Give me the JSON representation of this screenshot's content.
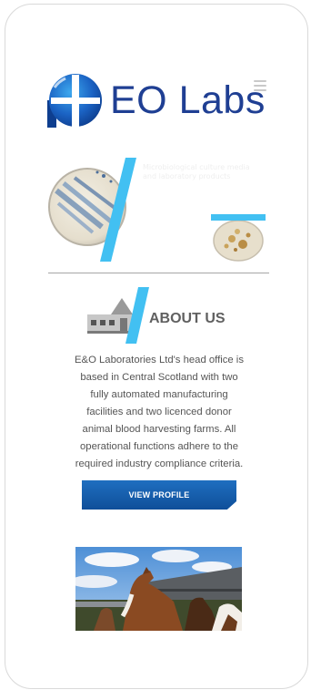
{
  "header": {
    "logo_text": "EO Labs",
    "menu_icon": "hamburger-menu-icon"
  },
  "banner": {
    "caption": "Microbiological culture media and laboratory products"
  },
  "about": {
    "title": "ABOUT US",
    "icon": "farm-building-icon",
    "body_lines": [
      "E&O Laboratories Ltd's head office is",
      "based in Central Scotland with two",
      "fully automated manufacturing",
      "facilities and two licenced donor",
      "animal blood harvesting farms. All",
      "operational functions adhere to the",
      "required industry compliance criteria."
    ],
    "button_label": "VIEW PROFILE"
  },
  "colors": {
    "brand_blue": "#1f3f93",
    "accent_cyan": "#42c0f2",
    "button_blue": "#1566b4",
    "text_gray": "#555555"
  }
}
